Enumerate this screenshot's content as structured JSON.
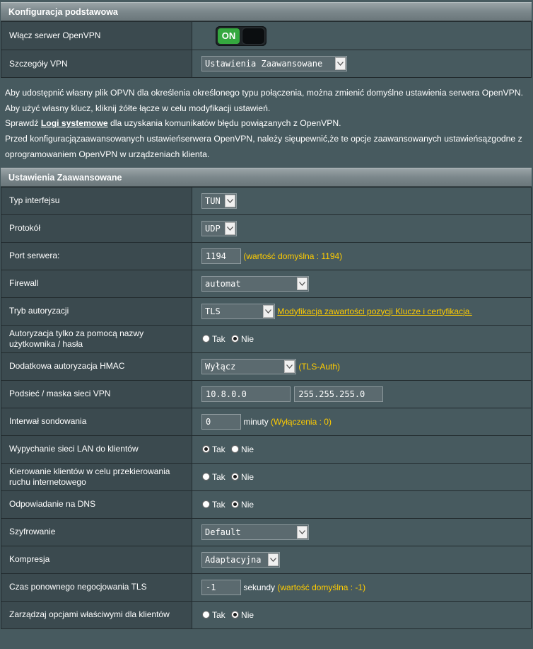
{
  "basic": {
    "header": "Konfiguracja podstawowa",
    "enable_label": "Włącz serwer OpenVPN",
    "toggle_state": "ON",
    "details_label": "Szczegóły VPN",
    "details_value": "Ustawienia Zaawansowane"
  },
  "info": {
    "line1": "Aby udostępnić własny plik OPVN dla określenia określonego typu połączenia, można zmienić domyślne ustawienia serwera OpenVPN.",
    "line2": "Aby użyć własny klucz, kliknij żółte łącze w celu modyfikacji ustawień.",
    "line3_pre": "Sprawdź ",
    "line3_link": "Logi systemowe",
    "line3_post": " dla uzyskania komunikatów błędu powiązanych z OpenVPN.",
    "line4": "Przed konfiguracjązaawansowanych ustawieńserwera OpenVPN, należy sięupewnić,że te opcje zaawansowanych ustawieńsązgodne z oprogramowaniem OpenVPN w urządzeniach klienta."
  },
  "advanced": {
    "header": "Ustawienia Zaawansowane",
    "interface": {
      "label": "Typ interfejsu",
      "value": "TUN"
    },
    "protocol": {
      "label": "Protokół",
      "value": "UDP"
    },
    "port": {
      "label": "Port serwera:",
      "value": "1194",
      "hint": "(wartość domyślna : 1194)"
    },
    "firewall": {
      "label": "Firewall",
      "value": "automat"
    },
    "auth_mode": {
      "label": "Tryb autoryzacji",
      "value": "TLS",
      "link": "Modyfikacja zawartości pozycji Klucze i certyfikacja."
    },
    "user_auth": {
      "label": "Autoryzacja tylko za pomocą nazwy użytkownika / hasła",
      "yes": "Tak",
      "no": "Nie",
      "selected": "no"
    },
    "hmac": {
      "label": "Dodatkowa autoryzacja HMAC",
      "value": "Wyłącz",
      "hint": "(TLS-Auth)"
    },
    "subnet": {
      "label": "Podsieć / maska sieci VPN",
      "network": "10.8.0.0",
      "mask": "255.255.255.0"
    },
    "poll": {
      "label": "Interwał sondowania",
      "value": "0",
      "unit": "minuty",
      "hint": "(Wyłączenia : 0)"
    },
    "push_lan": {
      "label": "Wypychanie sieci LAN do klientów",
      "yes": "Tak",
      "no": "Nie",
      "selected": "yes"
    },
    "redirect": {
      "label": "Kierowanie klientów w celu przekierowania ruchu internetowego",
      "yes": "Tak",
      "no": "Nie",
      "selected": "no"
    },
    "dns": {
      "label": "Odpowiadanie na DNS",
      "yes": "Tak",
      "no": "Nie",
      "selected": "no"
    },
    "cipher": {
      "label": "Szyfrowanie",
      "value": "Default"
    },
    "compression": {
      "label": "Kompresja",
      "value": "Adaptacyjna"
    },
    "reneg": {
      "label": "Czas ponownego negocjowania TLS",
      "value": "-1",
      "unit": "sekundy",
      "hint": "(wartość domyślna : -1)"
    },
    "client_opts": {
      "label": "Zarządzaj opcjami właściwymi dla klientów",
      "yes": "Tak",
      "no": "Nie",
      "selected": "no"
    }
  },
  "colors": {
    "accent_yellow": "#ffcc00",
    "toggle_on": "#35a83f",
    "background": "#475a5f",
    "label_bg": "#3b4a4f"
  },
  "icons": {
    "dropdown": "chevron-down-icon"
  }
}
